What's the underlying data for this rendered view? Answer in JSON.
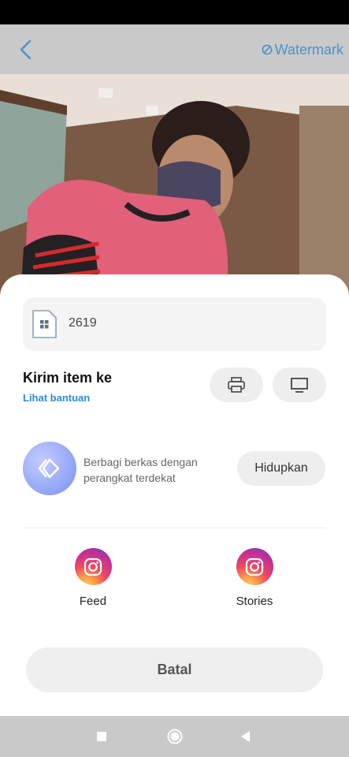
{
  "header": {
    "watermark_label": "Watermark"
  },
  "file": {
    "name": "2619"
  },
  "send": {
    "title": "Kirim item ke",
    "help_link": "Lihat bantuan"
  },
  "nearby": {
    "description": "Berbagi berkas dengan perangkat terdekat",
    "enable_label": "Hidupkan"
  },
  "share_targets": [
    {
      "label": "Feed",
      "icon": "instagram-icon"
    },
    {
      "label": "Stories",
      "icon": "instagram-icon"
    }
  ],
  "cancel_label": "Batal",
  "colors": {
    "accent": "#2a8cd6",
    "watermark": "#4a93c9",
    "bars": "#c9c9c9"
  }
}
